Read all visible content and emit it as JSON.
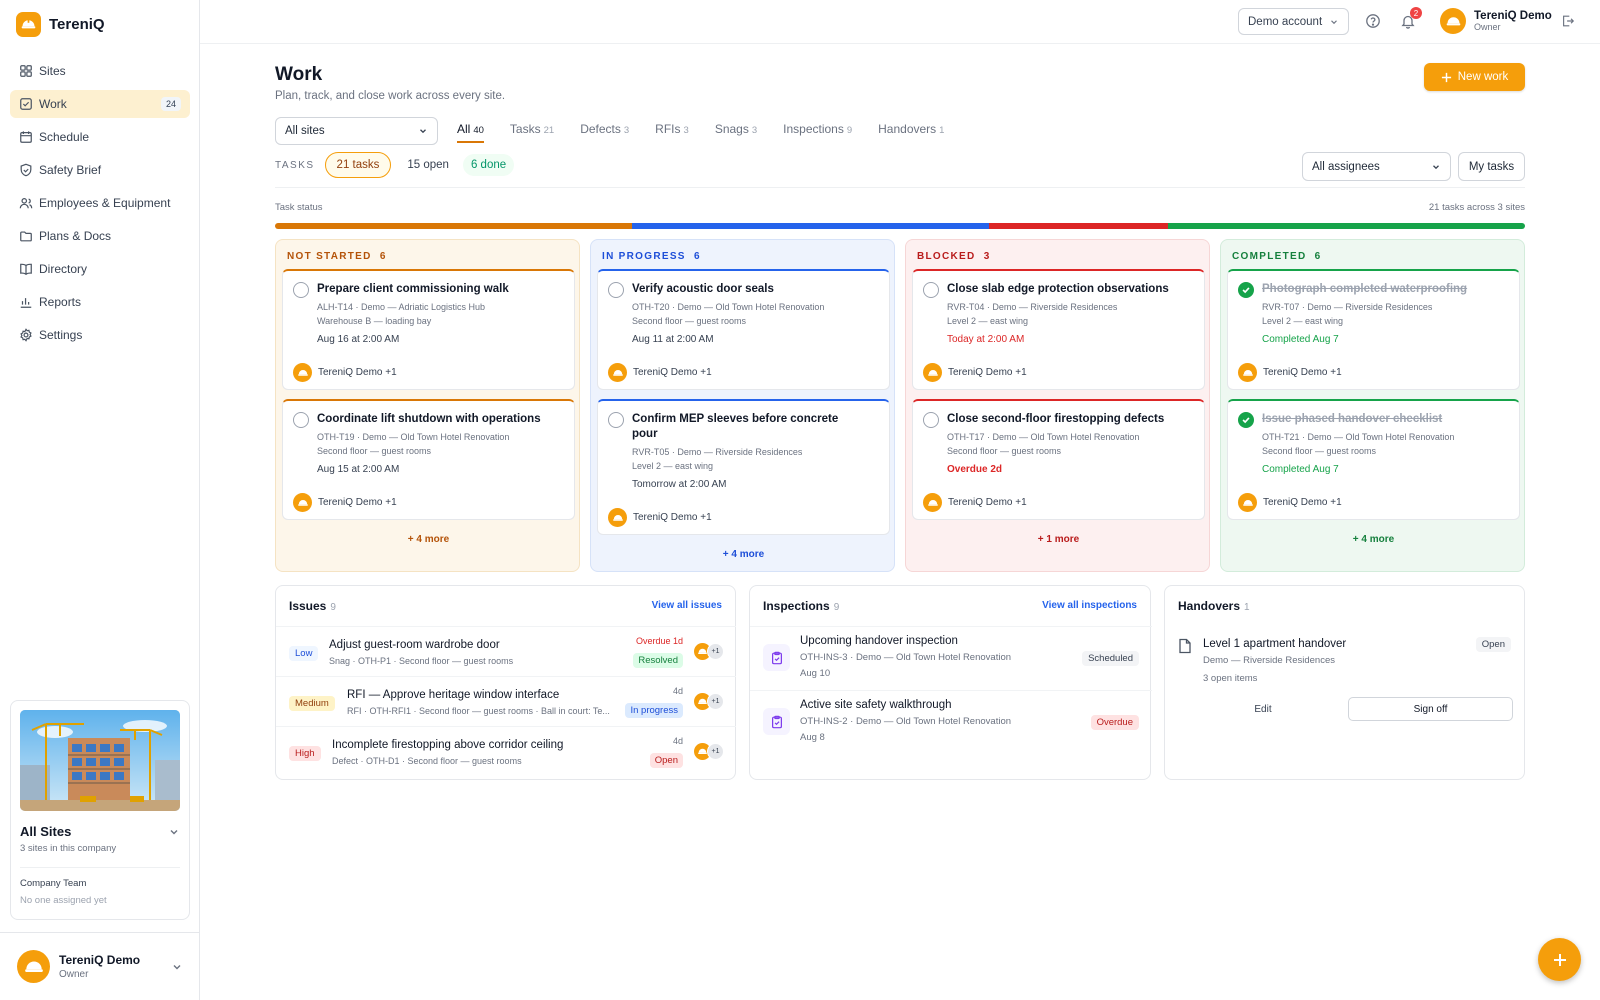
{
  "app": {
    "name": "TereniQ"
  },
  "sidebar": {
    "items": [
      {
        "label": "Sites",
        "icon": "grid-icon"
      },
      {
        "label": "Work",
        "icon": "checkbox-icon",
        "badge": "24"
      },
      {
        "label": "Schedule",
        "icon": "calendar-icon"
      },
      {
        "label": "Safety Brief",
        "icon": "shield-icon"
      },
      {
        "label": "Employees & Equipment",
        "icon": "people-icon"
      },
      {
        "label": "Plans & Docs",
        "icon": "folder-icon"
      },
      {
        "label": "Directory",
        "icon": "book-icon"
      },
      {
        "label": "Reports",
        "icon": "bar-chart-icon"
      },
      {
        "label": "Settings",
        "icon": "gear-icon"
      }
    ],
    "site_card": {
      "name": "All Sites",
      "sub": "3 sites in this company",
      "team_label": "Company Team",
      "team_value": "No one assigned yet"
    },
    "user": {
      "name": "TereniQ Demo",
      "role": "Owner"
    }
  },
  "topbar": {
    "account": "Demo account",
    "notifications": "2",
    "user_name": "TereniQ Demo",
    "user_role": "Owner"
  },
  "page": {
    "title": "Work",
    "subtitle": "Plan, track, and close work across every site.",
    "new_button": "New work"
  },
  "filters": {
    "site": "All sites",
    "tabs": [
      {
        "label": "All",
        "count": "40"
      },
      {
        "label": "Tasks",
        "count": "21"
      },
      {
        "label": "Defects",
        "count": "3"
      },
      {
        "label": "RFIs",
        "count": "3"
      },
      {
        "label": "Snags",
        "count": "3"
      },
      {
        "label": "Inspections",
        "count": "9"
      },
      {
        "label": "Handovers",
        "count": "1"
      }
    ],
    "tasks_label": "TASKS",
    "tasks_pill": "21 tasks",
    "open_pill": "15 open",
    "done_pill": "6 done",
    "assignee": "All assignees",
    "my_tasks": "My tasks"
  },
  "status": {
    "label": "Task status",
    "summary": "21 tasks across 3 sites",
    "segments": [
      6,
      6,
      3,
      6
    ]
  },
  "colors": {
    "accent": "#f59e0b",
    "not_started": "#d97706",
    "in_progress": "#2563eb",
    "blocked": "#dc2626",
    "completed": "#16a34a"
  },
  "columns": [
    {
      "title": "NOT STARTED",
      "count": "6",
      "more": "+ 4 more",
      "cards": [
        {
          "title": "Prepare client commissioning walk",
          "meta1": "ALH-T14 · Demo — Adriatic Logistics Hub",
          "meta2": "Warehouse B — loading bay",
          "due": "Aug 16 at 2:00 AM",
          "assignee": "TereniQ Demo +1"
        },
        {
          "title": "Coordinate lift shutdown with operations",
          "meta1": "OTH-T19 · Demo — Old Town Hotel Renovation",
          "meta2": "Second floor — guest rooms",
          "due": "Aug 15 at 2:00 AM",
          "assignee": "TereniQ Demo +1"
        }
      ]
    },
    {
      "title": "IN PROGRESS",
      "count": "6",
      "more": "+ 4 more",
      "cards": [
        {
          "title": "Verify acoustic door seals",
          "meta1": "OTH-T20 · Demo — Old Town Hotel Renovation",
          "meta2": "Second floor — guest rooms",
          "due": "Aug 11 at 2:00 AM",
          "assignee": "TereniQ Demo +1"
        },
        {
          "title": "Confirm MEP sleeves before concrete pour",
          "meta1": "RVR-T05 · Demo — Riverside Residences",
          "meta2": "Level 2 — east wing",
          "due": "Tomorrow at 2:00 AM",
          "assignee": "TereniQ Demo +1"
        }
      ]
    },
    {
      "title": "BLOCKED",
      "count": "3",
      "more": "+ 1 more",
      "cards": [
        {
          "title": "Close slab edge protection observations",
          "meta1": "RVR-T04 · Demo — Riverside Residences",
          "meta2": "Level 2 — east wing",
          "due": "Today at 2:00 AM",
          "assignee": "TereniQ Demo +1"
        },
        {
          "title": "Close second-floor firestopping defects",
          "meta1": "OTH-T17 · Demo — Old Town Hotel Renovation",
          "meta2": "Second floor — guest rooms",
          "due": "Overdue 2d",
          "assignee": "TereniQ Demo +1"
        }
      ]
    },
    {
      "title": "COMPLETED",
      "count": "6",
      "more": "+ 4 more",
      "cards": [
        {
          "title": "Photograph completed waterproofing",
          "meta1": "RVR-T07 · Demo — Riverside Residences",
          "meta2": "Level 2 — east wing",
          "due": "Completed Aug 7",
          "assignee": "TereniQ Demo +1"
        },
        {
          "title": "Issue phased handover checklist",
          "meta1": "OTH-T21 · Demo — Old Town Hotel Renovation",
          "meta2": "Second floor — guest rooms",
          "due": "Completed Aug 7",
          "assignee": "TereniQ Demo +1"
        }
      ]
    }
  ],
  "issues": {
    "title": "Issues",
    "count": "9",
    "link": "View all issues",
    "items": [
      {
        "priority": "Low",
        "title": "Adjust guest-room wardrobe door",
        "meta": "Snag · OTH-P1 · Second floor — guest rooms",
        "age": "Overdue 1d",
        "status": "Resolved",
        "plus": "+1"
      },
      {
        "priority": "Medium",
        "title": "RFI — Approve heritage window interface",
        "meta": "RFI · OTH-RFI1 · Second floor — guest rooms · Ball in court: Te...",
        "age": "4d",
        "status": "In progress",
        "plus": "+1"
      },
      {
        "priority": "High",
        "title": "Incomplete firestopping above corridor ceiling",
        "meta": "Defect · OTH-D1 · Second floor — guest rooms",
        "age": "4d",
        "status": "Open",
        "plus": "+1"
      }
    ]
  },
  "inspections": {
    "title": "Inspections",
    "count": "9",
    "link": "View all inspections",
    "items": [
      {
        "title": "Upcoming handover inspection",
        "meta": "OTH-INS-3 · Demo — Old Town Hotel Renovation",
        "date": "Aug 10",
        "status": "Scheduled"
      },
      {
        "title": "Active site safety walkthrough",
        "meta": "OTH-INS-2 · Demo — Old Town Hotel Renovation",
        "date": "Aug 8",
        "status": "Overdue"
      }
    ]
  },
  "handovers": {
    "title": "Handovers",
    "count": "1",
    "item": {
      "title": "Level 1 apartment handover",
      "site": "Demo — Riverside Residences",
      "sub": "3 open items",
      "status": "Open",
      "edit": "Edit",
      "sign_off": "Sign off"
    }
  }
}
